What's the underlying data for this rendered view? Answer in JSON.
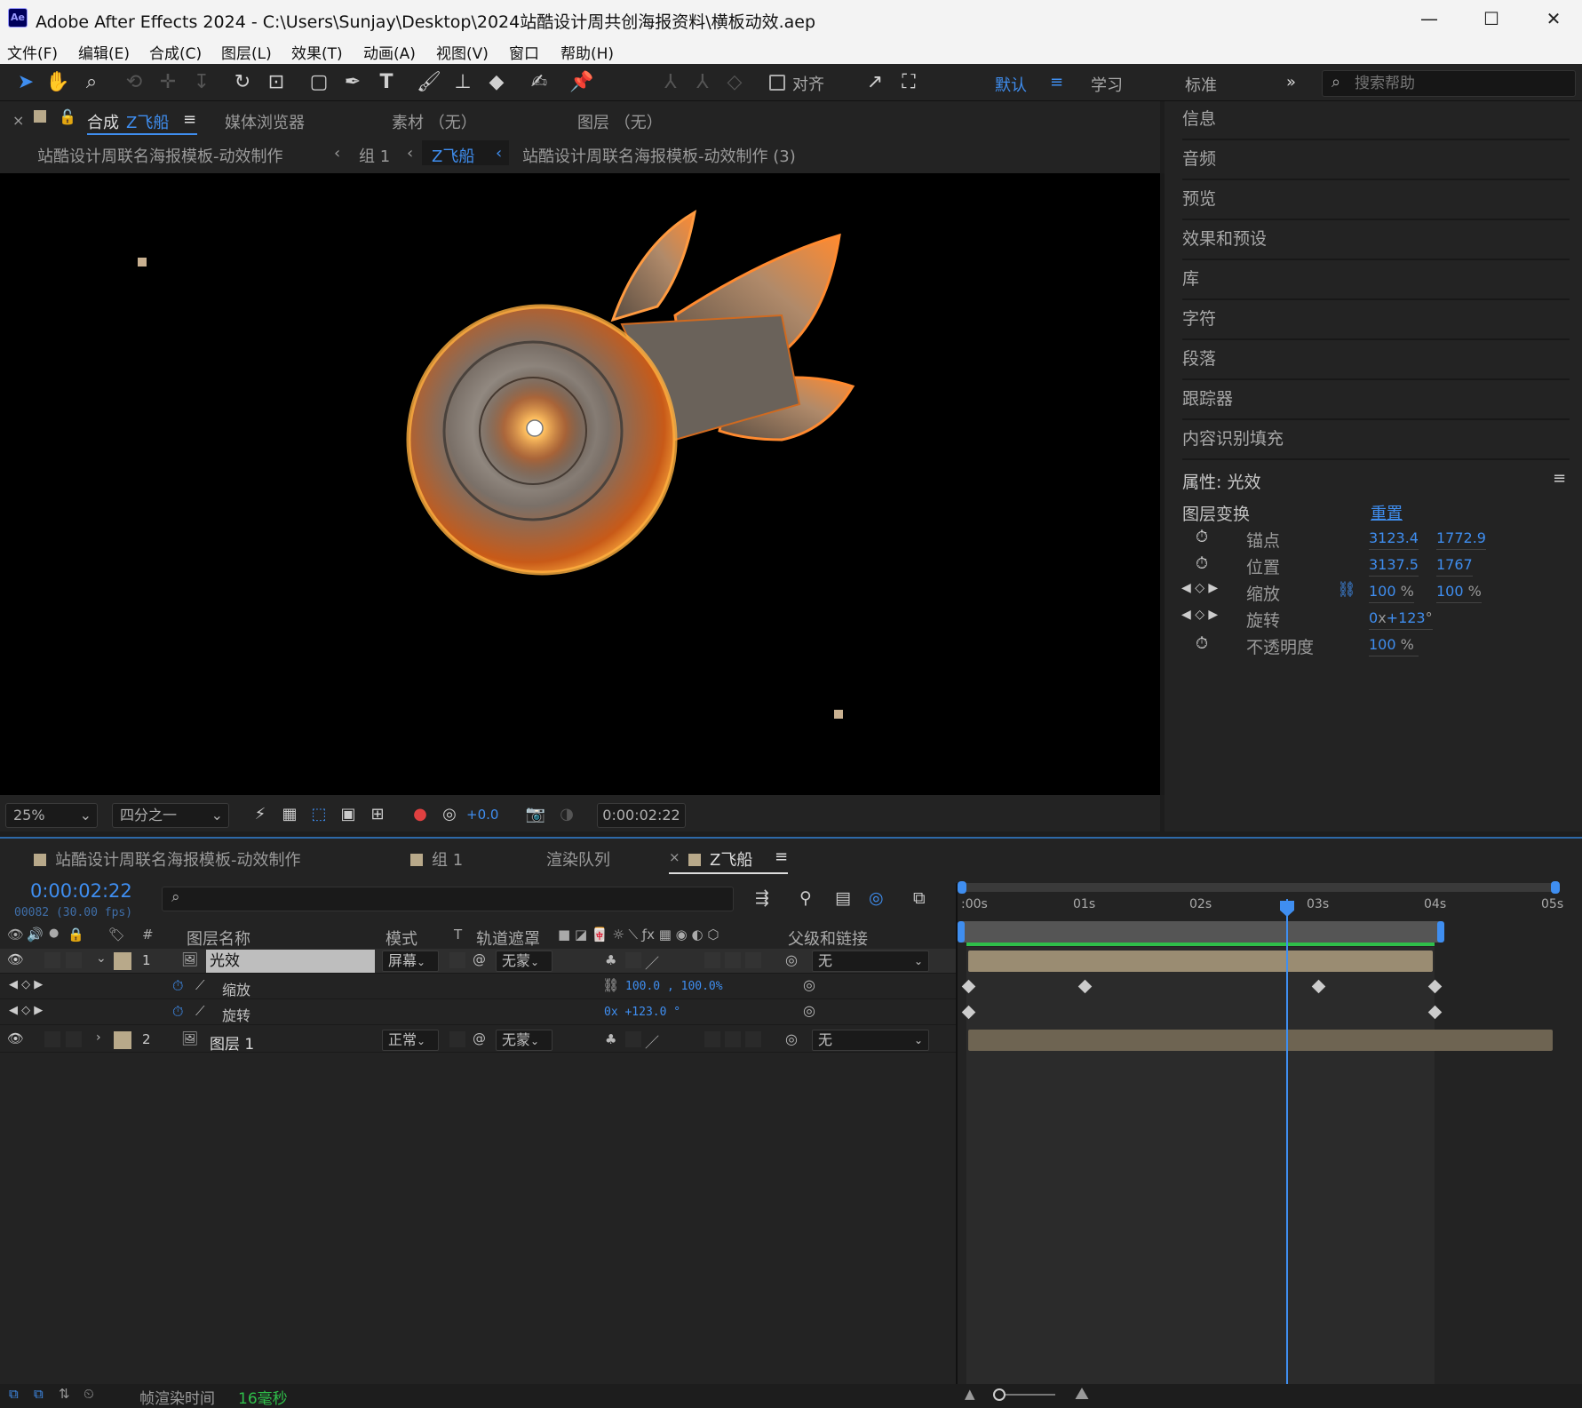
{
  "titlebar": {
    "logo": "Ae",
    "title": "Adobe After Effects 2024 - C:\\Users\\Sunjay\\Desktop\\2024站酷设计周共创海报资料\\横板动效.aep",
    "minimize": "—",
    "maximize": "☐",
    "close": "✕"
  },
  "menu": [
    "文件(F)",
    "编辑(E)",
    "合成(C)",
    "图层(L)",
    "效果(T)",
    "动画(A)",
    "视图(V)",
    "窗口",
    "帮助(H)"
  ],
  "toolbar": {
    "align_label": "对齐",
    "workspaces": [
      "默认",
      "学习",
      "标准"
    ],
    "more": "»",
    "search_placeholder": "搜索帮助"
  },
  "viewer_panel": {
    "tabs": {
      "close": "×",
      "comp_prefix": "合成",
      "comp_name": "Z飞船",
      "media": "媒体浏览器",
      "footage": "素材 （无）",
      "layer": "图层 （无）"
    },
    "breadcrumbs": [
      "站酷设计周联名海报模板-动效制作",
      "组 1",
      "Z飞船",
      "站酷设计周联名海报模板-动效制作 (3)"
    ],
    "zoom": "25%",
    "resolution": "四分之一",
    "exposure": "+0.0",
    "timecode": "0:00:02:22"
  },
  "right_panel": {
    "items": [
      "信息",
      "音频",
      "预览",
      "效果和预设",
      "库",
      "字符",
      "段落",
      "跟踪器",
      "内容识别填充"
    ],
    "properties_title": "属性: 光效",
    "transform_label": "图层变换",
    "reset": "重置",
    "props": [
      {
        "name": "锚点",
        "v1": "3123.4",
        "v2": "1772.9"
      },
      {
        "name": "位置",
        "v1": "3137.5",
        "v2": "1767"
      },
      {
        "name": "缩放",
        "v1": "100",
        "u1": "%",
        "v2": "100",
        "u2": "%"
      },
      {
        "name": "旋转",
        "v1": "0",
        "u1": "x",
        "v2": "+123",
        "u2": "°"
      },
      {
        "name": "不透明度",
        "v1": "100",
        "u1": "%"
      }
    ]
  },
  "timeline": {
    "tabs": [
      "站酷设计周联名海报模板-动效制作",
      "组 1",
      "渲染队列",
      "Z飞船"
    ],
    "timecode": "0:00:02:22",
    "frame_info": "00082 (30.00 fps)",
    "columns": {
      "num": "#",
      "name": "图层名称",
      "mode": "模式",
      "t": "T",
      "matte": "轨道遮罩",
      "parent": "父级和链接"
    },
    "layers": [
      {
        "num": "1",
        "name": "光效",
        "mode": "屏幕",
        "matte": "无蒙",
        "parent": "无"
      },
      {
        "num": "2",
        "name": "图层 1",
        "mode": "正常",
        "matte": "无蒙",
        "parent": "无"
      }
    ],
    "sub_props": [
      {
        "name": "缩放",
        "value": "100.0 , 100.0%"
      },
      {
        "name": "旋转",
        "value": "0x +123.0 °"
      }
    ],
    "ruler": [
      ":00s",
      "01s",
      "02s",
      "03s",
      "04s",
      "05s"
    ]
  },
  "status": {
    "label": "帧渲染时间",
    "value": "16毫秒"
  },
  "colors": {
    "accent": "#3f8ef0",
    "label_tan": "#b8a98a",
    "panel": "#232323",
    "green_bar": "#2fbf4a"
  }
}
